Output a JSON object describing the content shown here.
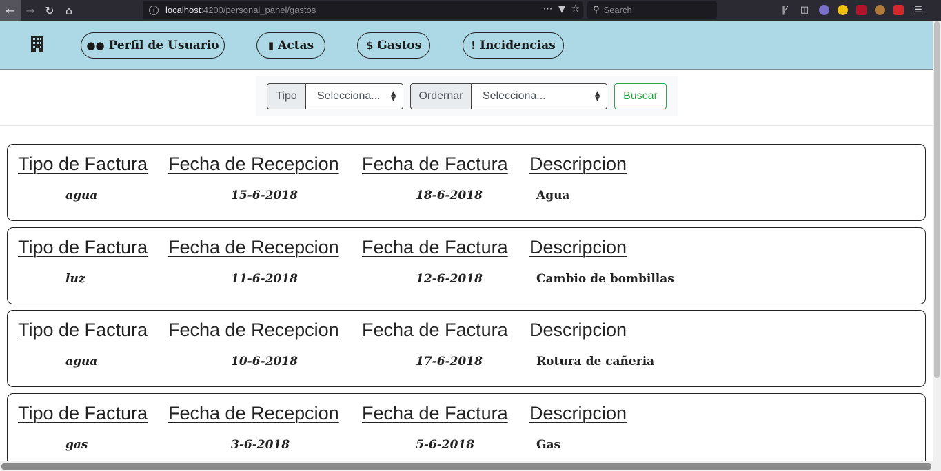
{
  "browser": {
    "url_host": "localhost",
    "url_path": ":4200/personal_panel/gastos",
    "search_placeholder": "Search"
  },
  "nav": {
    "items": [
      {
        "label": "Perfil de Usuario",
        "icon": "users-icon"
      },
      {
        "label": "Actas",
        "icon": "book-icon"
      },
      {
        "label": "Gastos",
        "icon": "dollar-icon"
      },
      {
        "label": "Incidencias",
        "icon": "exclamation-icon"
      }
    ]
  },
  "filter": {
    "tipo_label": "Tipo",
    "tipo_value": "Selecciona...",
    "ordenar_label": "Ordernar",
    "ordenar_value": "Selecciona...",
    "search_button": "Buscar"
  },
  "table_headers": {
    "tipo": "Tipo de Factura",
    "fecha_recepcion": "Fecha de Recepcion",
    "fecha_factura": "Fecha de Factura",
    "descripcion": "Descripcion"
  },
  "facturas": [
    {
      "tipo": "agua",
      "fecha_recepcion": "15-6-2018",
      "fecha_factura": "18-6-2018",
      "descripcion": "Agua"
    },
    {
      "tipo": "luz",
      "fecha_recepcion": "11-6-2018",
      "fecha_factura": "12-6-2018",
      "descripcion": "Cambio de bombillas"
    },
    {
      "tipo": "agua",
      "fecha_recepcion": "10-6-2018",
      "fecha_factura": "17-6-2018",
      "descripcion": "Rotura de cañeria"
    },
    {
      "tipo": "gas",
      "fecha_recepcion": "3-6-2018",
      "fecha_factura": "5-6-2018",
      "descripcion": "Gas"
    }
  ]
}
